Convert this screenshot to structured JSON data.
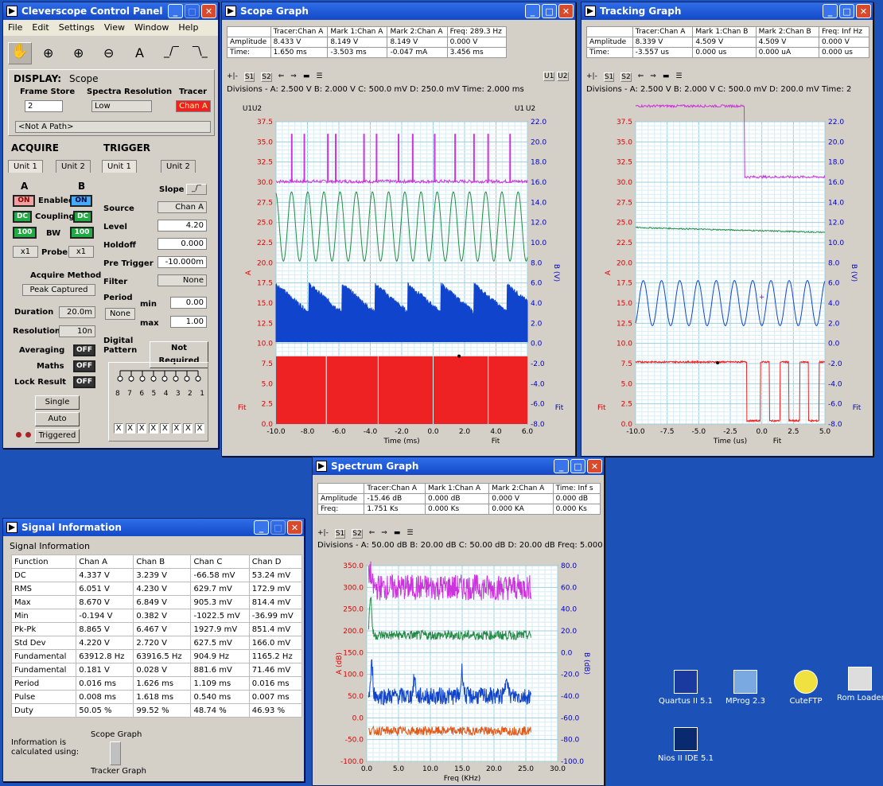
{
  "colors": {
    "desktop": "#1c52b8",
    "magenta": "#cc33dd",
    "green": "#228b44",
    "blue": "#1144cc",
    "red": "#ee2222",
    "orange": "#e05a1a"
  },
  "control": {
    "title": "Cleverscope Control Panel",
    "menu": [
      "File",
      "Edit",
      "Settings",
      "View",
      "Window",
      "Help"
    ],
    "display_label": "DISPLAY:",
    "display_value": "Scope",
    "frame_store": "Frame Store",
    "frame_value": "2",
    "spectra_res": "Spectra Resolution",
    "spectra_value": "Low",
    "tracer": "Tracer",
    "tracer_value": "Chan A",
    "path": "<Not A Path>",
    "acquire": "ACQUIRE",
    "trigger": "TRIGGER",
    "unit1": "Unit 1",
    "unit2": "Unit 2",
    "a": "A",
    "b": "B",
    "on": "ON",
    "enabled": "Enabled",
    "dc": "DC",
    "coupling": "Coupling",
    "hundred": "100",
    "bw": "BW",
    "x1": "x1",
    "probe": "Probe",
    "acq_method": "Acquire Method",
    "acq_value": "Peak Captured",
    "duration": "Duration",
    "duration_value": "20.0m",
    "resolution": "Resolution",
    "resolution_value": "10n",
    "averaging": "Averaging",
    "maths": "Maths",
    "lock": "Lock Result",
    "off": "OFF",
    "single": "Single",
    "auto": "Auto",
    "triggered": "Triggered",
    "slope": "Slope",
    "source": "Source",
    "source_value": "Chan A",
    "level": "Level",
    "level_value": "4.20",
    "holdoff": "Holdoff",
    "holdoff_value": "0.000",
    "pretrig": "Pre Trigger",
    "pretrig_value": "-10.000m",
    "filter": "Filter",
    "filter_value": "None",
    "period": "Period",
    "period_value": "None",
    "min": "min",
    "min_value": "0.00",
    "max": "max",
    "max_value": "1.00",
    "digital": "Digital Pattern",
    "not_required": "Not Required",
    "bits": [
      "8",
      "7",
      "6",
      "5",
      "4",
      "3",
      "2",
      "1"
    ],
    "xs": [
      "X",
      "X",
      "X",
      "X",
      "X",
      "X",
      "X",
      "X"
    ]
  },
  "scope": {
    "title": "Scope Graph",
    "hdr": [
      "",
      "Tracer:Chan A",
      "Mark 1:Chan A",
      "Mark 2:Chan A",
      "Freq:  289.3 Hz"
    ],
    "row1": [
      "Amplitude",
      "8.433 V",
      "8.149 V",
      "8.149 V",
      "0.000 V"
    ],
    "row2": [
      "Time:",
      "1.650 ms",
      "-3.503 ms",
      "-0.047 mA",
      "3.456 ms"
    ],
    "div": "Divisions -  A: 2.500 V   B: 2.000 V   C: 500.0 mV   D: 250.0 mV   Time: 2.000 ms",
    "s1": "S1",
    "s2": "S2",
    "u1": "U1",
    "u2": "U2",
    "fit": "Fit",
    "yleft": [
      "37.5",
      "35.0",
      "32.5",
      "30.0",
      "27.5",
      "25.0",
      "22.5",
      "20.0",
      "17.5",
      "15.0",
      "12.5",
      "10.0",
      "7.5",
      "5.0",
      "2.5",
      "0.0"
    ],
    "yright": [
      "22.0",
      "20.0",
      "18.0",
      "16.0",
      "14.0",
      "12.0",
      "10.0",
      "8.0",
      "6.0",
      "4.0",
      "2.0",
      "0.0",
      "-2.0",
      "-4.0",
      "-6.0",
      "-8.0"
    ],
    "x": [
      "-10.0",
      "-8.0",
      "-6.0",
      "-4.0",
      "-2.0",
      "0.0",
      "2.0",
      "4.0",
      "6.0"
    ],
    "xlabel": "Time (ms)",
    "ylabel_l": "A",
    "ylabel_r": "B (V)"
  },
  "tracking": {
    "title": "Tracking Graph",
    "hdr": [
      "",
      "Tracer:Chan A",
      "Mark 1:Chan B",
      "Mark 2:Chan B",
      "Freq:  Inf Hz"
    ],
    "row1": [
      "Amplitude",
      "8.339 V",
      "4.509 V",
      "4.509 V",
      "0.000 V"
    ],
    "row2": [
      "Time:",
      "-3.557 us",
      "0.000 us",
      "0.000 uA",
      "0.000 us"
    ],
    "div": "Divisions -  A: 2.500 V   B: 2.000 V   C: 500.0 mV   D: 200.0 mV   Time: 2",
    "x": [
      "-10.0",
      "-7.5",
      "-5.0",
      "-2.5",
      "0.0",
      "2.5",
      "5.0"
    ],
    "xlabel": "Time (us)"
  },
  "spectrum": {
    "title": "Spectrum Graph",
    "hdr": [
      "",
      "Tracer:Chan A",
      "Mark 1:Chan A",
      "Mark 2:Chan A",
      "Time:  Inf s"
    ],
    "row1": [
      "Amplitude",
      "-15.46 dB",
      "0.000 dB",
      "0.000 V",
      "0.000 dB"
    ],
    "row2": [
      "Freq:",
      "1.751 Ks",
      "0.000 Ks",
      "0.000 KA",
      "0.000 Ks"
    ],
    "div": "Divisions -  A: 50.00 dB   B: 20.00 dB   C: 50.00 dB   D: 20.00 dB   Freq: 5.000",
    "yleft": [
      "350.0",
      "300.0",
      "250.0",
      "200.0",
      "150.0",
      "100.0",
      "50.0",
      "0.0",
      "-50.0",
      "-100.0"
    ],
    "yright": [
      "80.0",
      "60.0",
      "40.0",
      "20.0",
      "0.0",
      "-20.0",
      "-40.0",
      "-60.0",
      "-80.0",
      "-100.0"
    ],
    "x": [
      "0.0",
      "5.0",
      "10.0",
      "15.0",
      "20.0",
      "25.0",
      "30.0"
    ],
    "xlabel": "Freq (KHz)",
    "ylabel_l": "A (dB)",
    "ylabel_r": "B (dB)"
  },
  "signal": {
    "title": "Signal Information",
    "group": "Signal Information",
    "head": [
      "Function",
      "Chan A",
      "Chan B",
      "Chan C",
      "Chan D"
    ],
    "rows": [
      [
        "DC",
        "4.337 V",
        "3.239 V",
        "-66.58 mV",
        "53.24 mV"
      ],
      [
        "RMS",
        "6.051 V",
        "4.230 V",
        "629.7 mV",
        "172.9 mV"
      ],
      [
        "Max",
        "8.670 V",
        "6.849 V",
        "905.3 mV",
        "814.4 mV"
      ],
      [
        "Min",
        "-0.194 V",
        "0.382 V",
        "-1022.5 mV",
        "-36.99 mV"
      ],
      [
        "Pk-Pk",
        "8.865 V",
        "6.467 V",
        "1927.9 mV",
        "851.4 mV"
      ],
      [
        "Std Dev",
        "4.220 V",
        "2.720 V",
        "627.5 mV",
        "166.0 mV"
      ],
      [
        "Fundamental",
        "63912.8 Hz",
        "63916.5 Hz",
        "904.9 Hz",
        "1165.2 Hz"
      ],
      [
        "Fundamental",
        "0.181 V",
        "0.028 V",
        "881.6 mV",
        "71.46 mV"
      ],
      [
        "Period",
        "0.016 ms",
        "1.626 ms",
        "1.109 ms",
        "0.016 ms"
      ],
      [
        "Pulse",
        "0.008 ms",
        "1.618 ms",
        "0.540 ms",
        "0.007 ms"
      ],
      [
        "Duty",
        "50.05 %",
        "99.52 %",
        "48.74 %",
        "46.93 %"
      ]
    ],
    "info": "Information is calculated using:",
    "scope_opt": "Scope Graph",
    "tracker_opt": "Tracker Graph"
  },
  "desktop": {
    "icons": [
      "Quartus II 5.1",
      "MProg 2.3",
      "CuteFTP",
      "Rom Loader",
      "Nios II IDE 5.1"
    ]
  }
}
